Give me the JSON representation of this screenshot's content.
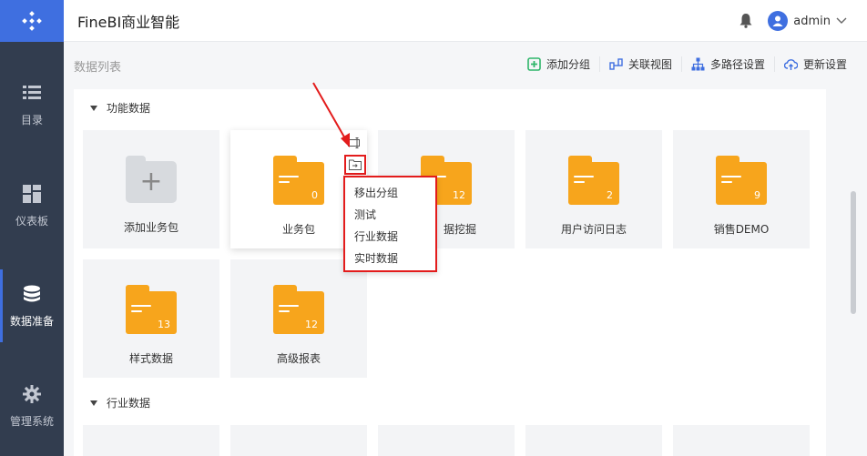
{
  "header": {
    "title": "FineBI商业智能",
    "user": "admin"
  },
  "sidebar": {
    "items": [
      {
        "label": "目录",
        "icon": "list-icon"
      },
      {
        "label": "仪表板",
        "icon": "dashboard-icon"
      },
      {
        "label": "数据准备",
        "icon": "database-icon"
      },
      {
        "label": "管理系统",
        "icon": "gear-icon"
      }
    ]
  },
  "breadcrumb": "数据列表",
  "toolbar": {
    "add_group": "添加分组",
    "relation_view": "关联视图",
    "multipath": "多路径设置",
    "update": "更新设置"
  },
  "sections": [
    {
      "title": "功能数据"
    },
    {
      "title": "行业数据"
    }
  ],
  "cards": [
    {
      "label": "添加业务包",
      "count": ""
    },
    {
      "label": "业务包",
      "count": "0"
    },
    {
      "label": "据挖掘",
      "count": "12"
    },
    {
      "label": "用户访问日志",
      "count": "2"
    },
    {
      "label": "销售DEMO",
      "count": "9"
    },
    {
      "label": "样式数据",
      "count": "13"
    },
    {
      "label": "高级报表",
      "count": "12"
    }
  ],
  "dropdown": {
    "items": [
      "移出分组",
      "测试",
      "行业数据",
      "实时数据"
    ]
  },
  "colors": {
    "accent": "#3f6fe0",
    "folder": "#f7a51c",
    "highlight": "#e31c1c",
    "sidebar": "#323d4f"
  }
}
